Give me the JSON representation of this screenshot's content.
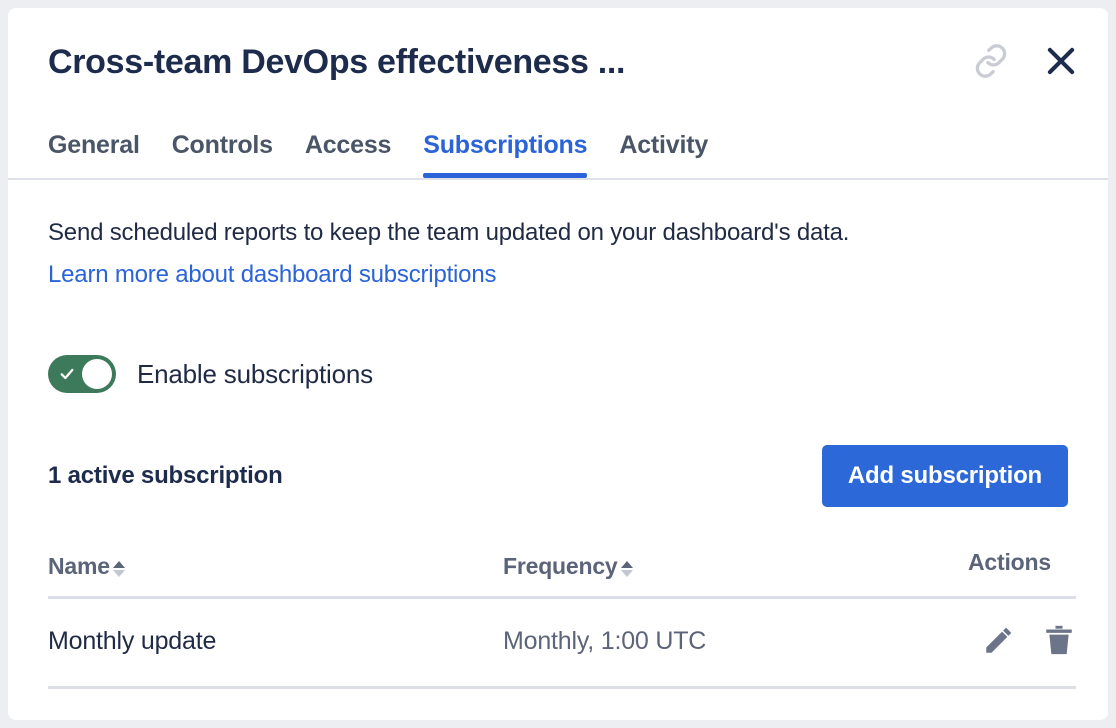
{
  "dialog": {
    "title": "Cross-team DevOps effectiveness ...",
    "link_icon": "link-icon",
    "close_icon": "close-icon"
  },
  "tabs": [
    {
      "label": "General",
      "active": false
    },
    {
      "label": "Controls",
      "active": false
    },
    {
      "label": "Access",
      "active": false
    },
    {
      "label": "Subscriptions",
      "active": true
    },
    {
      "label": "Activity",
      "active": false
    }
  ],
  "subscriptions_panel": {
    "description": "Send scheduled reports to keep the team updated on your dashboard's data.",
    "learn_more_label": "Learn more about dashboard subscriptions",
    "toggle": {
      "label": "Enable subscriptions",
      "enabled": true,
      "on_color": "#3d7a5b"
    },
    "count_label": "1 active subscription",
    "add_button_label": "Add subscription",
    "add_button_color": "#2d68d8",
    "table": {
      "columns": {
        "name": "Name",
        "frequency": "Frequency",
        "actions": "Actions"
      },
      "sort": {
        "column": "Name",
        "direction": "asc"
      },
      "rows": [
        {
          "name": "Monthly update",
          "frequency": "Monthly, 1:00 UTC",
          "edit_icon": "pencil-icon",
          "delete_icon": "trash-icon"
        }
      ]
    }
  },
  "colors": {
    "accent_blue": "#2a64d8",
    "title_navy": "#1d2b4c",
    "muted": "#5b6478",
    "page_bg": "#eceef2"
  }
}
